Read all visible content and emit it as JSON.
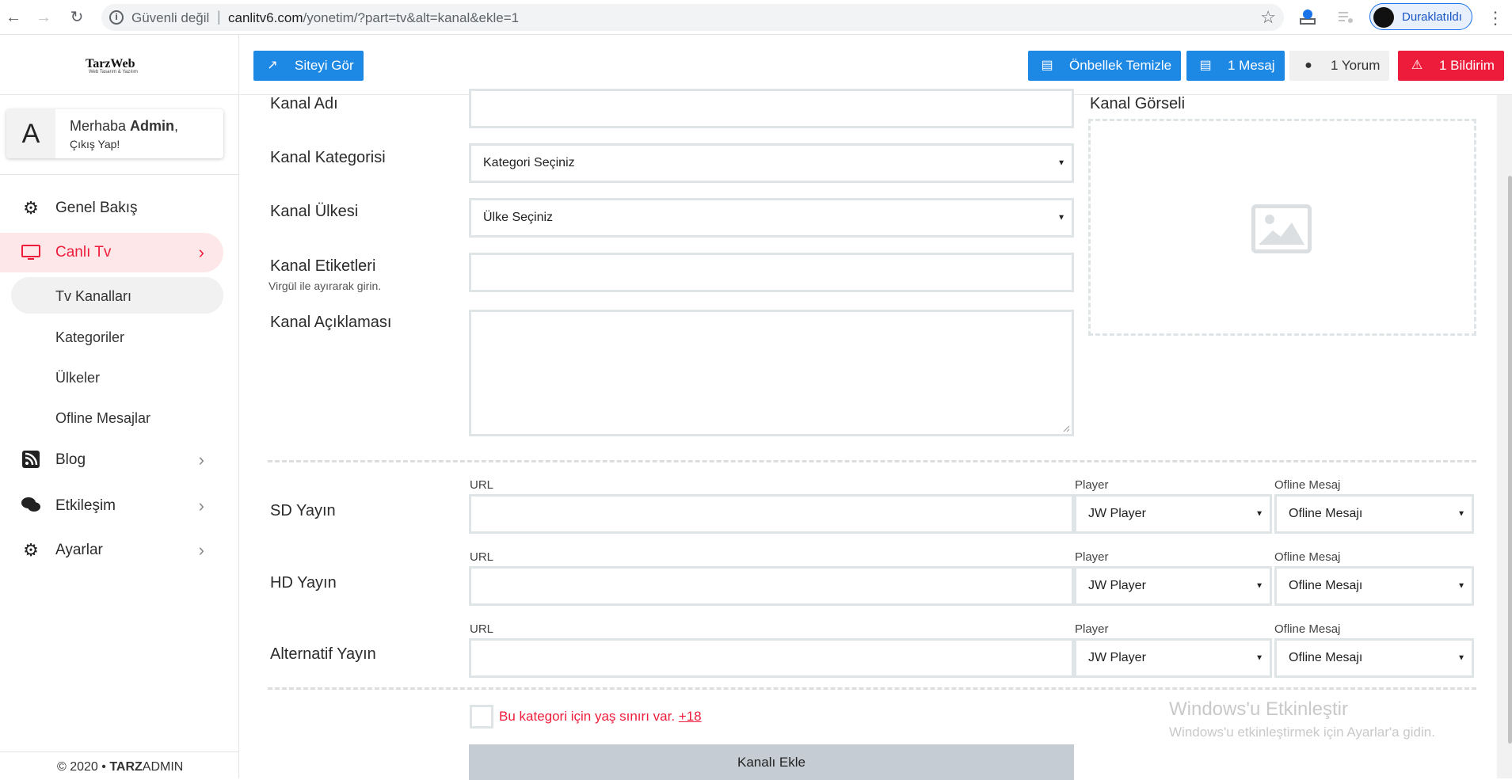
{
  "browser": {
    "security_label": "Güvenli değil",
    "url_host": "canlitv6.com",
    "url_path": "/yonetim/?part=tv&alt=kanal&ekle=1",
    "profile_label": "Duraklatıldı",
    "accent": "#1a73e8"
  },
  "header": {
    "logo_text": "TarzWeb",
    "logo_tagline": "Web Tasarım & Yazılım",
    "site_button": "Siteyi Gör",
    "cache_button": "Önbellek Temizle",
    "messages_button": "1 Mesaj",
    "comments_button": "1 Yorum",
    "notifications_button": "1 Bildirim",
    "colors": {
      "blue": "#1e88e5",
      "red": "#ee1c3b",
      "gray": "#f0f0f0"
    }
  },
  "sidebar": {
    "avatar_letter": "A",
    "greeting": "Merhaba ",
    "user_name": "Admin",
    "greeting_suffix": ",",
    "logout": "Çıkış Yap!",
    "items": [
      {
        "label": "Genel Bakış",
        "icon": "gear-icon"
      },
      {
        "label": "Canlı Tv",
        "icon": "monitor-icon",
        "active": true
      },
      {
        "label": "Blog",
        "icon": "rss-icon"
      },
      {
        "label": "Etkileşim",
        "icon": "comments-icon"
      },
      {
        "label": "Ayarlar",
        "icon": "cogs-icon"
      }
    ],
    "subitems": [
      {
        "label": "Tv Kanalları",
        "active": true
      },
      {
        "label": "Kategoriler"
      },
      {
        "label": "Ülkeler"
      },
      {
        "label": "Ofline Mesajlar"
      }
    ],
    "footer_prefix": "© 2020 • ",
    "footer_brand_bold": "TARZ",
    "footer_brand": "ADMIN"
  },
  "form": {
    "name_label": "Kanal Adı",
    "category_label": "Kanal Kategorisi",
    "category_value": "Kategori Seçiniz",
    "country_label": "Kanal Ülkesi",
    "country_value": "Ülke Seçiniz",
    "tags_label": "Kanal Etiketleri",
    "tags_hint": "Virgül ile ayırarak girin.",
    "description_label": "Kanal Açıklaması",
    "image_label": "Kanal Görseli",
    "url_label": "URL",
    "player_label": "Player",
    "offline_label": "Ofline Mesaj",
    "streams": [
      {
        "label": "SD Yayın",
        "player": "JW Player",
        "offline": "Ofline Mesajı"
      },
      {
        "label": "HD Yayın",
        "player": "JW Player",
        "offline": "Ofline Mesajı"
      },
      {
        "label": "Alternatif Yayın",
        "player": "JW Player",
        "offline": "Ofline Mesajı"
      }
    ],
    "age_text": "Bu kategori için yaş sınırı var. ",
    "age_link": "+18",
    "submit": "Kanalı Ekle"
  },
  "watermark": {
    "title": "Windows'u Etkinleştir",
    "subtitle": "Windows'u etkinleştirmek için Ayarlar'a gidin."
  }
}
